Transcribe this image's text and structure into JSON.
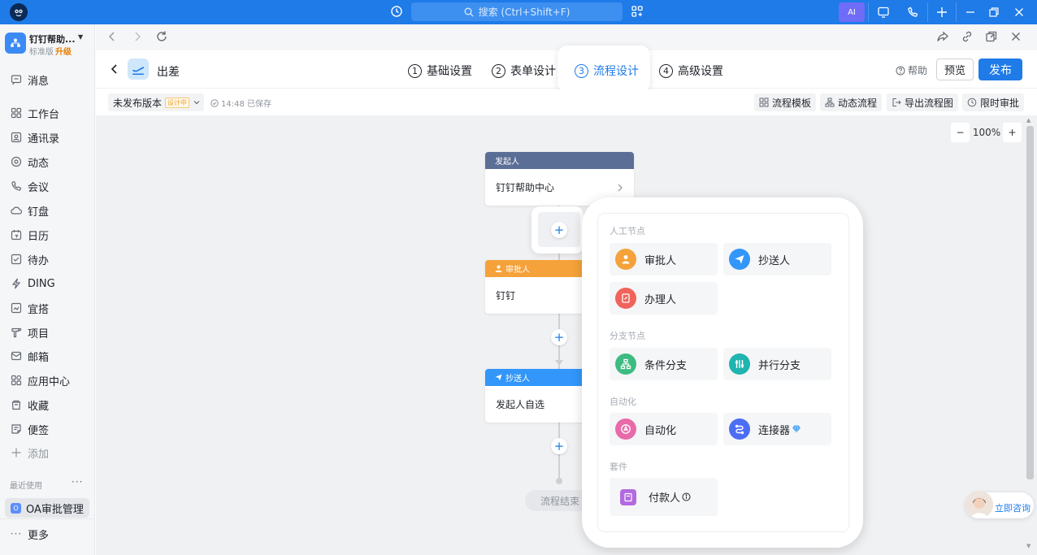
{
  "titlebar": {
    "search_placeholder": "搜索 (Ctrl+Shift+F)",
    "ai_label": "AI",
    "accent": "#1e7be8"
  },
  "org": {
    "name": "钉钉帮助...",
    "plan": "标准版",
    "upgrade": "升级"
  },
  "nav": [
    {
      "label": "消息",
      "icon": "message-icon"
    },
    {
      "label": "工作台",
      "icon": "workbench-icon"
    },
    {
      "label": "通讯录",
      "icon": "contacts-icon"
    },
    {
      "label": "动态",
      "icon": "feed-icon"
    },
    {
      "label": "会议",
      "icon": "meeting-icon"
    },
    {
      "label": "钉盘",
      "icon": "cloud-drive-icon"
    },
    {
      "label": "日历",
      "icon": "calendar-icon"
    },
    {
      "label": "待办",
      "icon": "todo-icon"
    },
    {
      "label": "DING",
      "icon": "ding-icon"
    },
    {
      "label": "宜搭",
      "icon": "yida-icon"
    },
    {
      "label": "项目",
      "icon": "project-icon"
    },
    {
      "label": "邮箱",
      "icon": "mail-icon"
    },
    {
      "label": "应用中心",
      "icon": "app-center-icon"
    },
    {
      "label": "收藏",
      "icon": "favorites-icon"
    },
    {
      "label": "便签",
      "icon": "note-icon"
    }
  ],
  "nav_add": "添加",
  "recent": {
    "title": "最近使用",
    "item": "OA审批管理",
    "item_badge": "O"
  },
  "nav_more": "更多",
  "header": {
    "form_title": "出差",
    "steps": [
      {
        "num": "1",
        "label": "基础设置"
      },
      {
        "num": "2",
        "label": "表单设计"
      },
      {
        "num": "3",
        "label": "流程设计"
      },
      {
        "num": "4",
        "label": "高级设置"
      }
    ],
    "help": "帮助",
    "preview": "预览",
    "publish": "发布"
  },
  "toolbar": {
    "version": "未发布版本",
    "version_tag": "设计中",
    "saved": "14:48 已保存",
    "template": "流程模板",
    "dynamic": "动态流程",
    "export": "导出流程图",
    "time_limit": "限时审批"
  },
  "zoom": {
    "level": "100%",
    "minus": "−",
    "plus": "+"
  },
  "flow": {
    "initiator": {
      "head": "发起人",
      "body": "钉钉帮助中心",
      "color": "#5a6e96"
    },
    "approver": {
      "head": "审批人",
      "body": "钉钉",
      "color": "#f5a23a"
    },
    "cc": {
      "head": "抄送人",
      "body": "发起人自选",
      "color": "#3296fa"
    },
    "end": "流程结束"
  },
  "popup": {
    "sec_manual": "人工节点",
    "approver": "审批人",
    "cc": "抄送人",
    "handler": "办理人",
    "sec_branch": "分支节点",
    "condition": "条件分支",
    "parallel": "并行分支",
    "sec_auto": "自动化",
    "automation": "自动化",
    "connector": "连接器",
    "sec_kit": "套件",
    "payer": "付款人",
    "colors": {
      "approver": "#f5a23a",
      "cc": "#3296fa",
      "handler": "#f0645c",
      "condition": "#3dbb82",
      "parallel": "#1fb4b0",
      "automation": "#e96aa8",
      "connector": "#4b6ef5",
      "payer": "#b36ae0"
    }
  },
  "consult": "立即咨询"
}
